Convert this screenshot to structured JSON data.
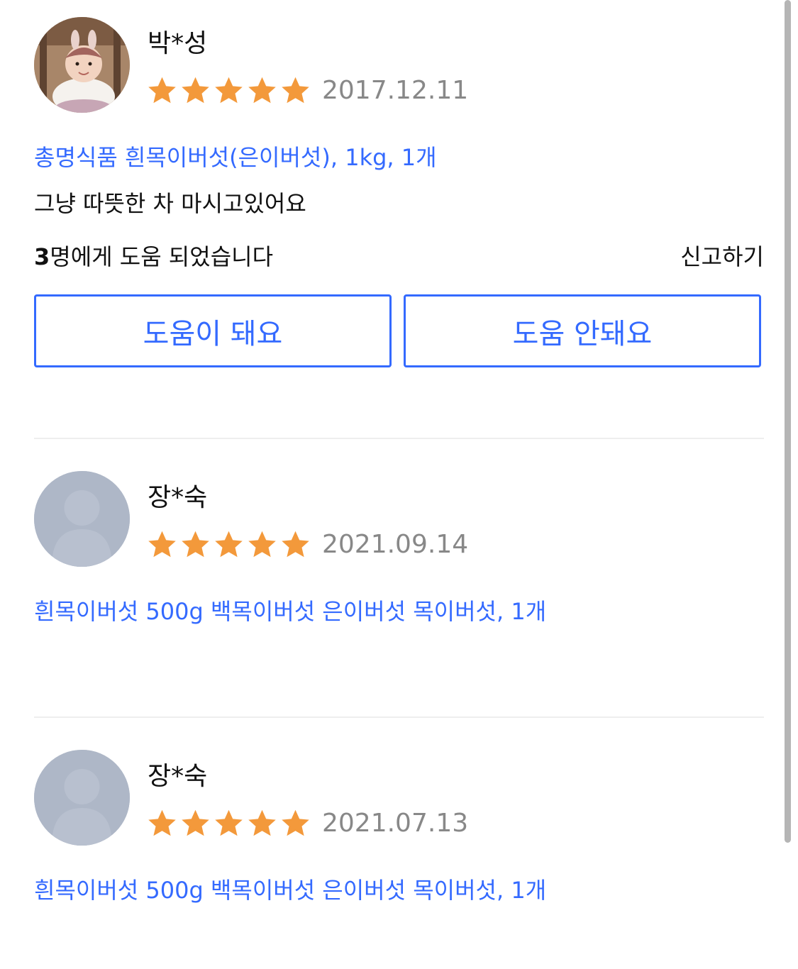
{
  "colors": {
    "accent": "#346aff",
    "star": "#f3993b",
    "date": "#888888",
    "divider": "#eeeeee",
    "default_avatar": "#aeb7c7"
  },
  "reviews": [
    {
      "author": "박*성",
      "avatar": "user-photo",
      "rating": 5,
      "date": "2017.12.11",
      "product": "총명식품 흰목이버섯(은이버섯), 1kg, 1개",
      "content": "그냥 따뜻한 차 마시고있어요",
      "helpful_count": "3",
      "helpful_suffix": "명에게 도움 되었습니다",
      "report_label": "신고하기",
      "helpful_button": "도움이 돼요",
      "not_helpful_button": "도움 안돼요"
    },
    {
      "author": "장*숙",
      "avatar": "default-avatar",
      "rating": 5,
      "date": "2021.09.14",
      "product": "흰목이버섯 500g 백목이버섯 은이버섯 목이버섯, 1개"
    },
    {
      "author": "장*숙",
      "avatar": "default-avatar",
      "rating": 5,
      "date": "2021.07.13",
      "product": "흰목이버섯 500g 백목이버섯 은이버섯 목이버섯, 1개"
    }
  ]
}
